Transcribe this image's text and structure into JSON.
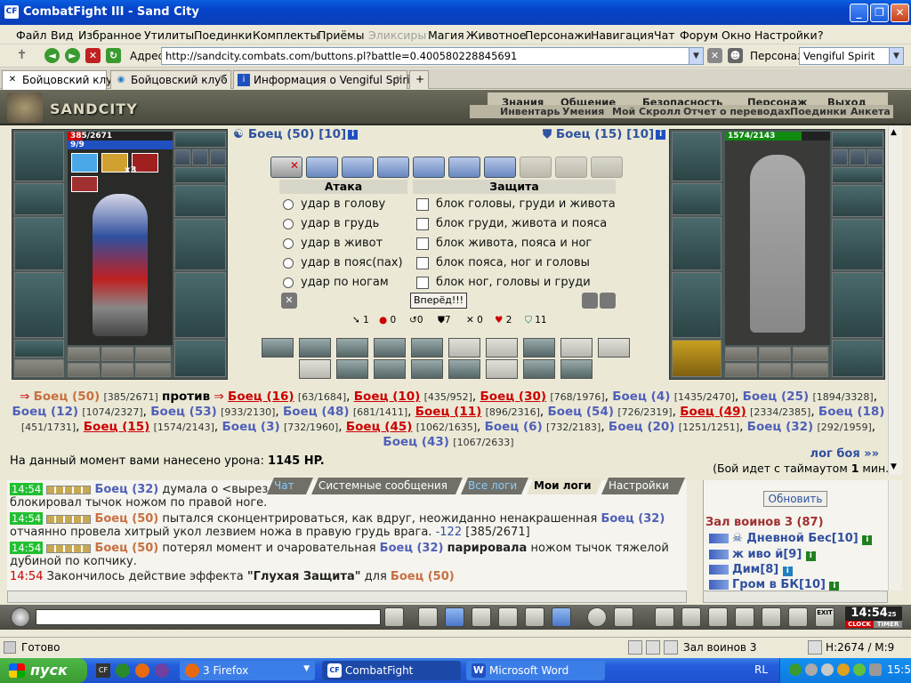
{
  "window": {
    "title": "CombatFight III - Sand City"
  },
  "menu": [
    "Файл",
    "Вид",
    "Избранное",
    "Утилиты",
    "Поединки",
    "Комплекты",
    "Приёмы",
    "Эликсиры",
    "Магия",
    "Животное",
    "Персонажи",
    "Навигация",
    "Чат",
    "Форум",
    "Окно",
    "Настройки",
    "?"
  ],
  "address": {
    "label": "Адрес:",
    "url": "http://sandcity.combats.com/buttons.pl?battle=0.400580228845691",
    "char_label": "Персонаж:",
    "char_value": "Vengiful Spirit"
  },
  "tabs": [
    "Бойцовский клуб",
    "Бойцовский клуб",
    "Информация о Vengiful Spirit"
  ],
  "game": {
    "logo": "SANDCITY",
    "nav_top": [
      "Знания",
      "Общение",
      "Безопасность",
      "Персонаж",
      "Выход"
    ],
    "nav_bottom": [
      "Инвентарь",
      "Умения",
      "Мой Скролл",
      "Отчет о переводах",
      "Поединки",
      "Анкета"
    ],
    "left_hp": "385/2671",
    "left_mana": "9/9",
    "left_stack": "x3",
    "right_hp": "1574/2143",
    "left_fighter": "Боец (50) [10]",
    "right_fighter": "Боец (15) [10]",
    "info": "i",
    "attack_title": "Атака",
    "defense_title": "Защита",
    "attacks": [
      "удар в голову",
      "удар в грудь",
      "удар в живот",
      "удар в пояс(пах)",
      "удар по ногам"
    ],
    "defenses": [
      "блок головы, груди и живота",
      "блок груди, живота и пояса",
      "блок живота, пояса и ног",
      "блок пояса, ног и головы",
      "блок ног, головы и груди"
    ],
    "go_button": "Вперёд!!!",
    "stats": [
      "1",
      "0",
      "0",
      "7",
      "0",
      "2",
      "11"
    ],
    "versus": "против",
    "leader": {
      "name": "Боец (50)",
      "hp": "[385/2671]"
    },
    "enemies": [
      {
        "name": "Боец (16)",
        "hp": "[63/1684]",
        "team": "red"
      },
      {
        "name": "Боец (10)",
        "hp": "[435/952]",
        "team": "red"
      },
      {
        "name": "Боец (30)",
        "hp": "[768/1976]",
        "team": "red"
      },
      {
        "name": "Боец (4)",
        "hp": "[1435/2470]",
        "team": "blue"
      },
      {
        "name": "Боец (25)",
        "hp": "[1894/3328]",
        "team": "blue"
      },
      {
        "name": "Боец (12)",
        "hp": "[1074/2327]",
        "team": "blue"
      },
      {
        "name": "Боец (53)",
        "hp": "[933/2130]",
        "team": "blue"
      },
      {
        "name": "Боец (48)",
        "hp": "[681/1411]",
        "team": "blue"
      },
      {
        "name": "Боец (11)",
        "hp": "[896/2316]",
        "team": "red"
      },
      {
        "name": "Боец (54)",
        "hp": "[726/2319]",
        "team": "blue"
      },
      {
        "name": "Боец (49)",
        "hp": "[2334/2385]",
        "team": "red"
      },
      {
        "name": "Боец (18)",
        "hp": "[451/1731]",
        "team": "blue"
      },
      {
        "name": "Боец (15)",
        "hp": "[1574/2143]",
        "team": "red"
      },
      {
        "name": "Боец (3)",
        "hp": "[732/1960]",
        "team": "blue"
      },
      {
        "name": "Боец (45)",
        "hp": "[1062/1635]",
        "team": "red"
      },
      {
        "name": "Боец (6)",
        "hp": "[732/2183]",
        "team": "blue"
      },
      {
        "name": "Боец (20)",
        "hp": "[1251/1251]",
        "team": "blue"
      },
      {
        "name": "Боец (32)",
        "hp": "[292/1959]",
        "team": "blue"
      },
      {
        "name": "Боец (43)",
        "hp": "[1067/2633]",
        "team": "blue"
      }
    ],
    "damage_prefix": "На данный момент вами нанесено урона:",
    "damage_value": "1145 HP.",
    "log_link": "лог боя »»",
    "timeout_prefix": "(Бой идет с таймаутом",
    "timeout_num": "1",
    "timeout_suffix": "мин.)"
  },
  "chat": {
    "tabs": [
      "Чат",
      "Системные сообщения",
      "Все логи",
      "Мои логи",
      "Настройки"
    ],
    "lines": [
      {
        "time": "14:54",
        "who": "Боец (32)",
        "text": "думала о <вырез"
      },
      {
        "text": "блокировал тычок ножом по правой ноге."
      },
      {
        "time": "14:54",
        "who": "Боец (50)",
        "text": "пытался сконцентрироваться, как вдруг, неожиданно ненакрашенная",
        "who2": "Боец (32)"
      },
      {
        "text": "отчаянно провела хитрый укол лезвием ножа в правую грудь врага.",
        "dmg": "-122",
        "hp": "[385/2671]"
      },
      {
        "time": "14:54",
        "who": "Боец (50)",
        "text": "потерял момент и очаровательная",
        "who2": "Боец (32)",
        "bold": "парировала",
        "tail": "ножом тычок тяжелой"
      },
      {
        "text": "дубиной по копчику."
      },
      {
        "time": "14:54",
        "text": "Закончилось действие эффекта",
        "effect": "\"Глухая Защита\"",
        "for": "для",
        "who": "Боец (50)"
      }
    ]
  },
  "room": {
    "refresh": "Обновить",
    "title": "Зал воинов 3 (87)",
    "users": [
      "Дневной Бес[10]",
      "ж иво й[9]",
      "Дим[8]",
      "Гром в БК[10]"
    ]
  },
  "toolbar": {
    "clock": "14:54",
    "clock_sec": "25",
    "clock_label": "CLOCK",
    "timer_label": "TIMER",
    "exit": "EXIT"
  },
  "status": {
    "ready": "Готово",
    "room": "Зал воинов 3",
    "hm": "H:2674 / M:9"
  },
  "taskbar": {
    "start": "пуск",
    "tasks": [
      "3 Firefox",
      "CombatFight",
      "Microsoft Word"
    ],
    "lang": "RL",
    "time": "15:54"
  }
}
